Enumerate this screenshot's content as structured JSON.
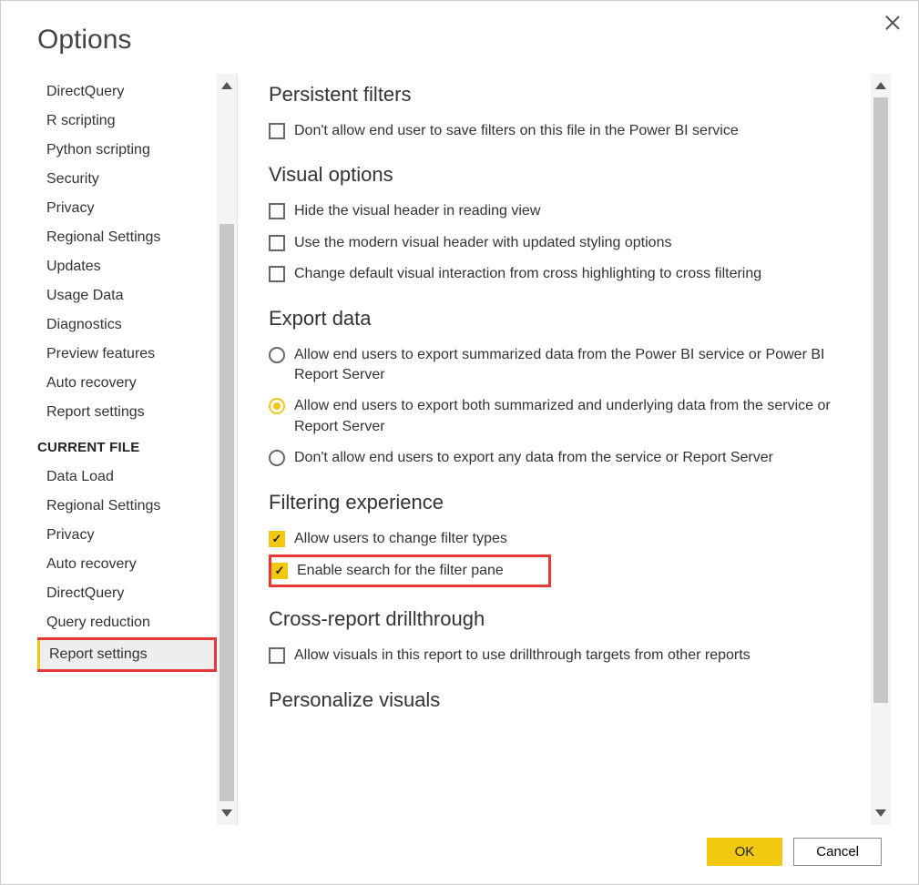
{
  "dialog": {
    "title": "Options",
    "ok": "OK",
    "cancel": "Cancel"
  },
  "sidebar": {
    "global": [
      "DirectQuery",
      "R scripting",
      "Python scripting",
      "Security",
      "Privacy",
      "Regional Settings",
      "Updates",
      "Usage Data",
      "Diagnostics",
      "Preview features",
      "Auto recovery",
      "Report settings"
    ],
    "current_head": "CURRENT FILE",
    "current": [
      "Data Load",
      "Regional Settings",
      "Privacy",
      "Auto recovery",
      "DirectQuery",
      "Query reduction",
      "Report settings"
    ],
    "selected": "Report settings"
  },
  "sections": {
    "persistent": {
      "title": "Persistent filters",
      "opts": [
        {
          "type": "cb",
          "checked": false,
          "label": "Don't allow end user to save filters on this file in the Power BI service"
        }
      ]
    },
    "visual": {
      "title": "Visual options",
      "opts": [
        {
          "type": "cb",
          "checked": false,
          "label": "Hide the visual header in reading view"
        },
        {
          "type": "cb",
          "checked": false,
          "label": "Use the modern visual header with updated styling options"
        },
        {
          "type": "cb",
          "checked": false,
          "label": "Change default visual interaction from cross highlighting to cross filtering"
        }
      ]
    },
    "export": {
      "title": "Export data",
      "opts": [
        {
          "type": "rb",
          "checked": false,
          "label": "Allow end users to export summarized data from the Power BI service or Power BI Report Server"
        },
        {
          "type": "rb",
          "checked": true,
          "label": "Allow end users to export both summarized and underlying data from the service or Report Server"
        },
        {
          "type": "rb",
          "checked": false,
          "label": "Don't allow end users to export any data from the service or Report Server"
        }
      ]
    },
    "filtering": {
      "title": "Filtering experience",
      "opts": [
        {
          "type": "cb",
          "checked": true,
          "label": "Allow users to change filter types"
        },
        {
          "type": "cb",
          "checked": true,
          "label": "Enable search for the filter pane",
          "highlight": true
        }
      ]
    },
    "cross": {
      "title": "Cross-report drillthrough",
      "opts": [
        {
          "type": "cb",
          "checked": false,
          "label": "Allow visuals in this report to use drillthrough targets from other reports"
        }
      ]
    },
    "personalize": {
      "title": "Personalize visuals"
    }
  }
}
